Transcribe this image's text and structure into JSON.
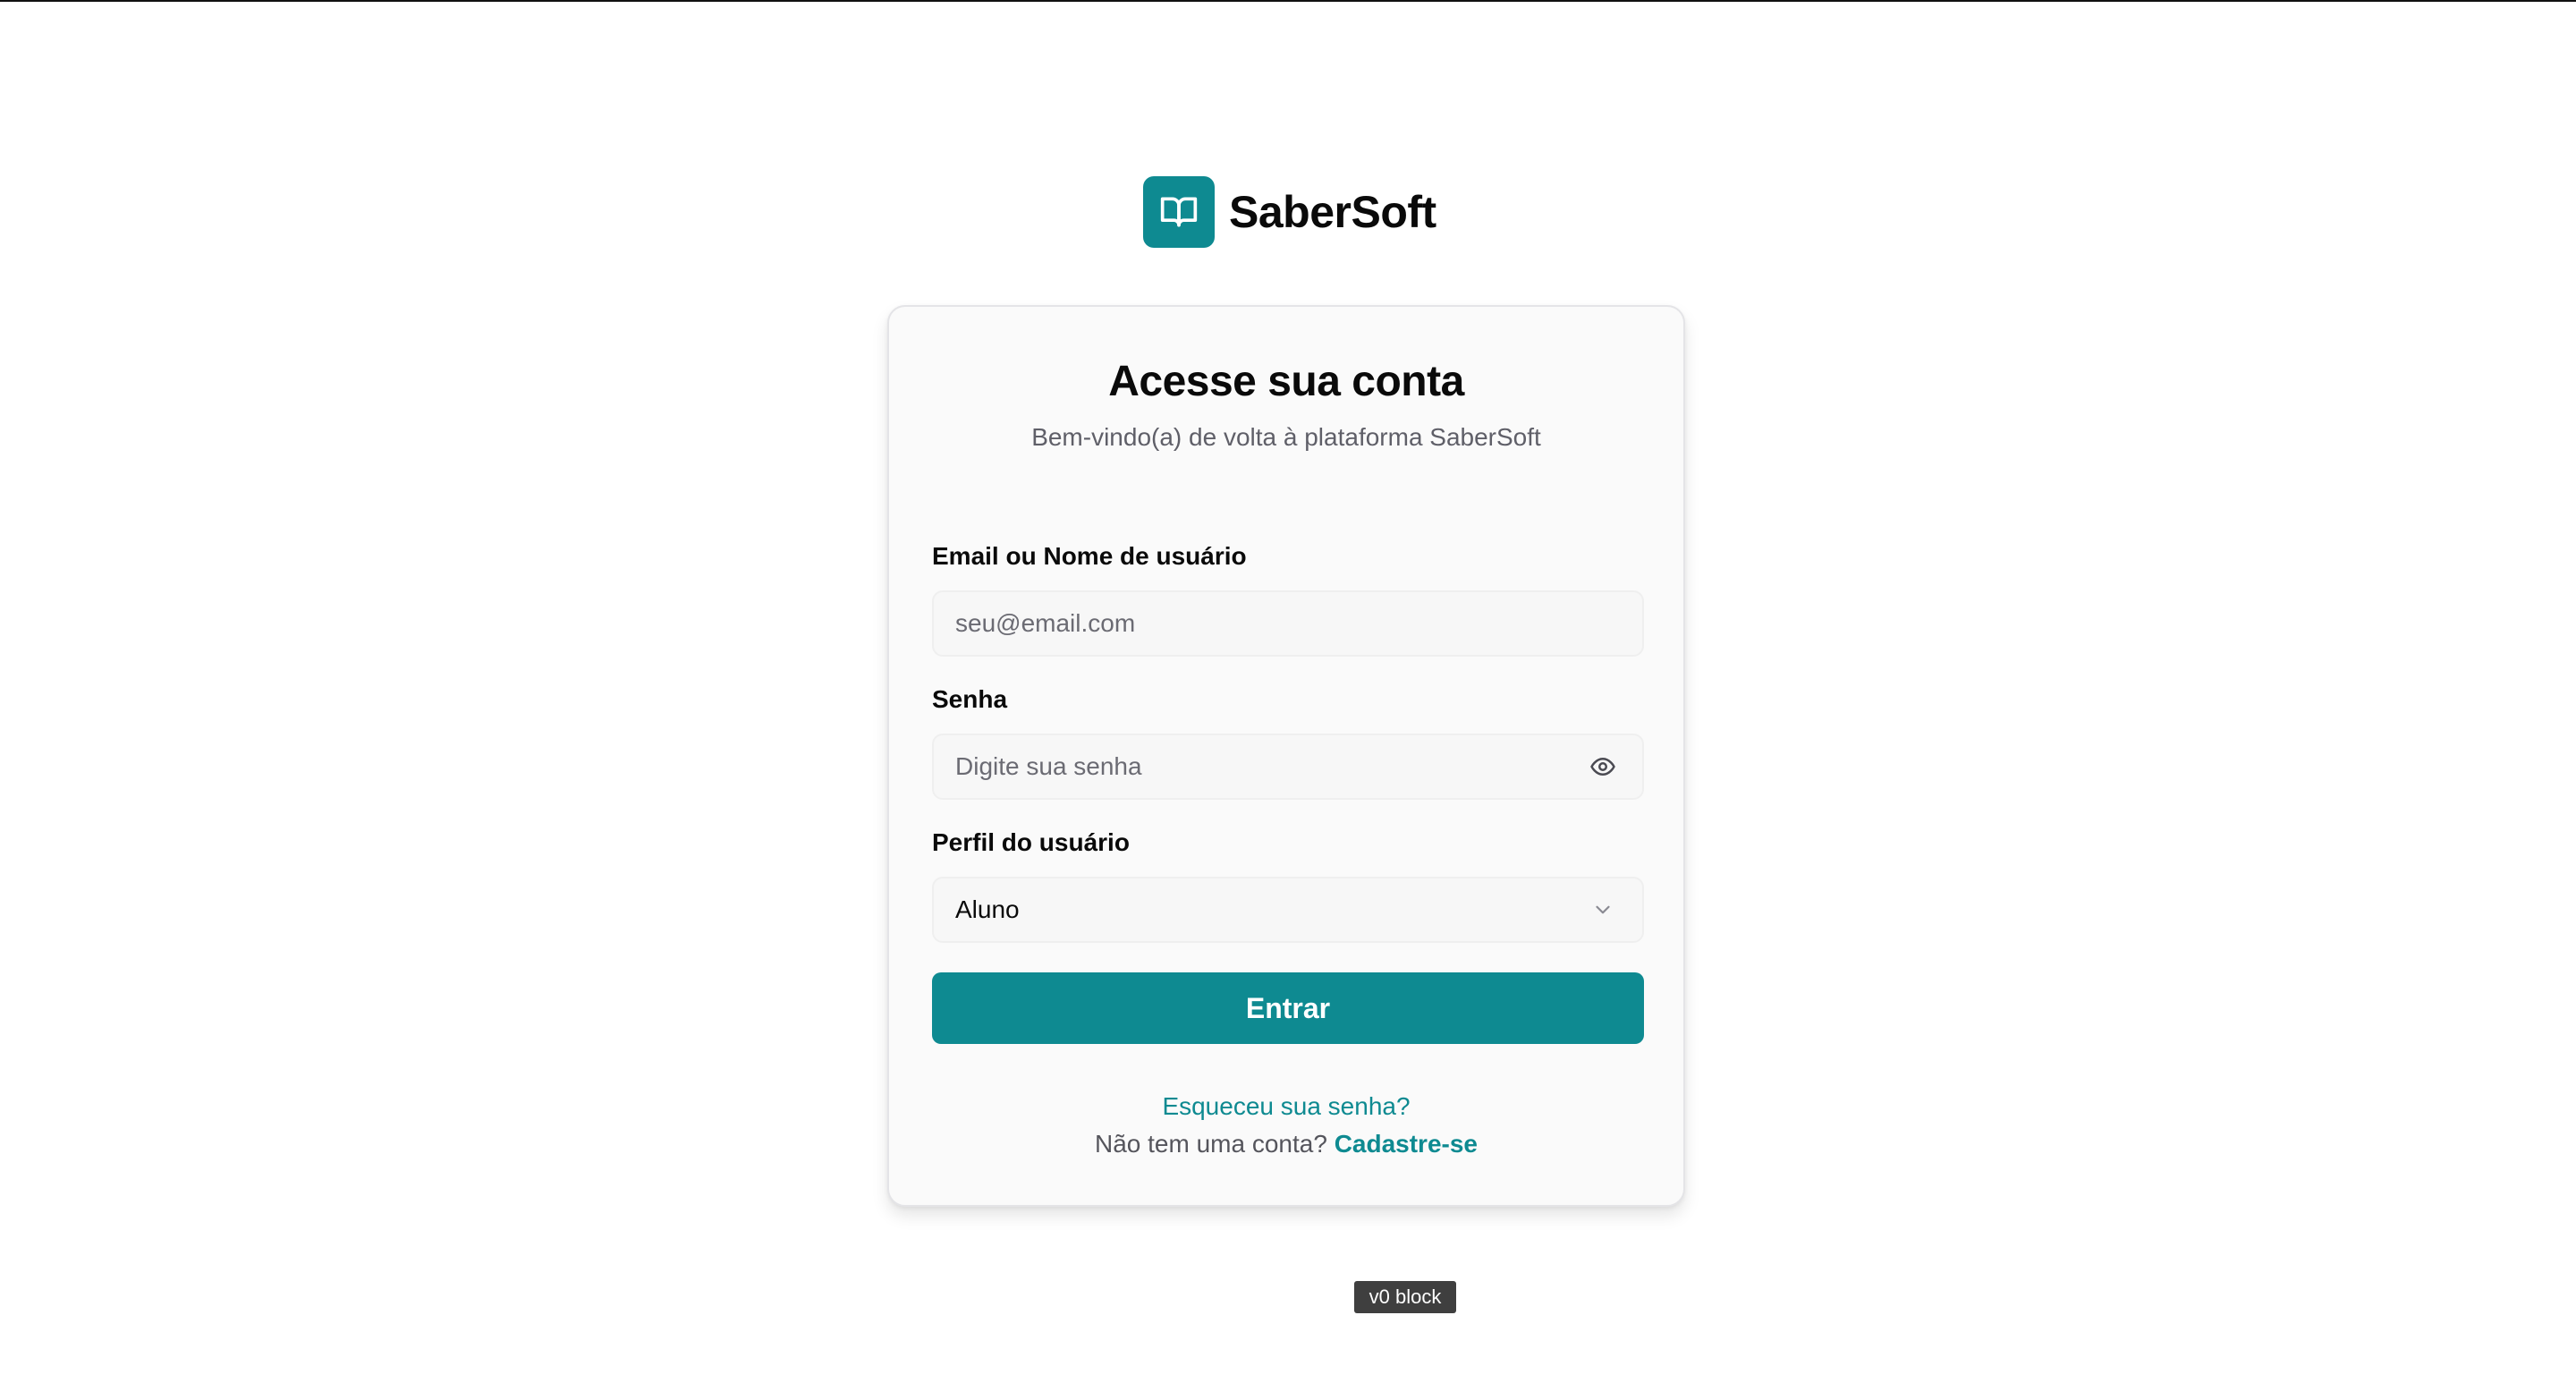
{
  "brand": {
    "name": "SaberSoft",
    "logo_icon": "open-book-icon",
    "color": "#0e8a91"
  },
  "card": {
    "title": "Acesse sua conta",
    "subtitle": "Bem-vindo(a) de volta à plataforma SaberSoft"
  },
  "form": {
    "email": {
      "label": "Email ou Nome de usuário",
      "placeholder": "seu@email.com",
      "value": ""
    },
    "password": {
      "label": "Senha",
      "placeholder": "Digite sua senha",
      "value": "",
      "toggle_icon": "eye-icon"
    },
    "profile": {
      "label": "Perfil do usuário",
      "selected": "Aluno",
      "chevron_icon": "chevron-down-icon"
    },
    "submit_label": "Entrar"
  },
  "links": {
    "forgot_password": "Esqueceu sua senha?",
    "no_account_text": "Não tem uma conta?",
    "signup": "Cadastre-se"
  },
  "badge": {
    "label": "v0 block"
  },
  "colors": {
    "accent": "#0e8a91",
    "card_background": "#fafafa",
    "muted_text": "#5f5f68"
  }
}
